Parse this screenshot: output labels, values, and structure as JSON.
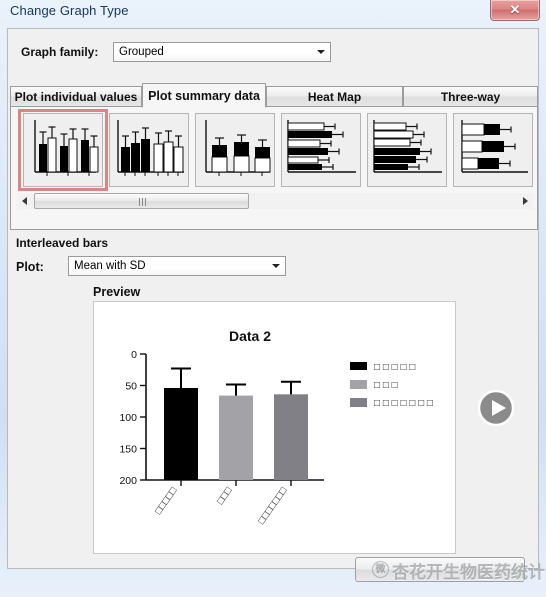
{
  "window": {
    "title": "Change Graph Type",
    "close_label": "✕"
  },
  "graph_family": {
    "label": "Graph family:",
    "value": "Grouped",
    "options": [
      "Grouped"
    ]
  },
  "tabs": [
    {
      "label": "Plot individual values",
      "active": false
    },
    {
      "label": "Plot summary data",
      "active": true
    },
    {
      "label": "Heat Map",
      "active": false
    },
    {
      "label": "Three-way",
      "active": false
    }
  ],
  "gallery": {
    "selected_index": 0,
    "thumbnails": [
      {
        "name": "interleaved-bars"
      },
      {
        "name": "grouped-bars"
      },
      {
        "name": "stacked-bars"
      },
      {
        "name": "horizontal-interleaved-bars"
      },
      {
        "name": "horizontal-grouped-bars"
      },
      {
        "name": "horizontal-stacked-bars"
      }
    ],
    "scrollbar": {
      "left_arrow": "◀",
      "right_arrow": "▶"
    }
  },
  "selection": {
    "title": "Interleaved bars"
  },
  "plot": {
    "label": "Plot:",
    "value": "Mean with SD",
    "options": [
      "Mean with SD"
    ]
  },
  "preview": {
    "label": "Preview",
    "play_button_label": "▶"
  },
  "footer": {
    "button_label": "",
    "watermark_text": "杏花开生物医药统计",
    "watermark_badge": "微"
  },
  "colors": {
    "series1": "#000000",
    "series2": "#a2a2a7",
    "series3": "#808086",
    "selection_highlight": "#d98686",
    "titlebar_text": "#15355b"
  },
  "chart_data": {
    "type": "bar",
    "title": "Data 2",
    "xlabel": "",
    "ylabel": "",
    "ylim": [
      0,
      200
    ],
    "yticks": [
      0,
      50,
      100,
      150,
      200
    ],
    "ytick_labels": [
      "0",
      "50",
      "100",
      "150",
      "200"
    ],
    "grid": false,
    "legend_position": "right",
    "categories": [
      "□□□□□",
      "□□□",
      "□□□□□□□"
    ],
    "legend": [
      "□ □ □ □ □",
      "□ □ □",
      "□ □ □ □ □ □ □"
    ],
    "values": [
      146,
      134,
      136
    ],
    "errors": [
      31,
      17,
      20
    ],
    "bar_colors": [
      "#000000",
      "#a2a2a7",
      "#808086"
    ],
    "error_bar_color": "#000000",
    "note": "Mean with SD; single series split by three groups, labels render as missing-glyph boxes"
  }
}
